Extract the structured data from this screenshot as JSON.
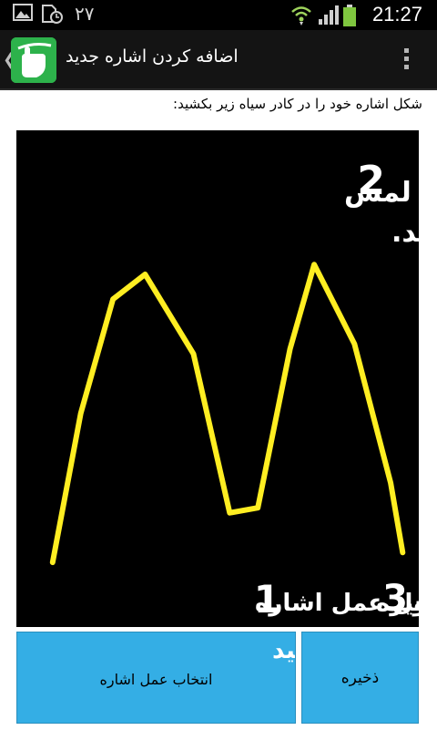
{
  "status_bar": {
    "time": "21:27",
    "notification_count": "۲۷",
    "icons": [
      "image-icon",
      "sd-card-icon",
      "wifi-icon",
      "signal-icon",
      "battery-icon"
    ]
  },
  "action_bar": {
    "title": "اضافه کردن اشاره جدید",
    "logo_icon": "hand-gesture-logo-icon",
    "overflow_icon": "overflow-menu-icon",
    "accent_color": "#2db24b"
  },
  "instruction": "شکل اشاره خود را در کادر سیاه زیر بکشید:",
  "canvas": {
    "background": "#000000",
    "stroke_color": "#ffee22",
    "overlay_lines": [
      "حرکت‌ها را با لمس",
      "صفحه بکشید."
    ],
    "step_2": "2",
    "bottom_step_3": "3",
    "bottom_text_a": "ذخیره",
    "bottom_step_1": "1",
    "bottom_text_b": "اول عمل اشاره",
    "gesture_points": [
      [
        0.09,
        0.87
      ],
      [
        0.16,
        0.57
      ],
      [
        0.24,
        0.34
      ],
      [
        0.32,
        0.29
      ],
      [
        0.44,
        0.45
      ],
      [
        0.53,
        0.77
      ],
      [
        0.6,
        0.76
      ],
      [
        0.68,
        0.44
      ],
      [
        0.74,
        0.27
      ],
      [
        0.84,
        0.43
      ],
      [
        0.93,
        0.71
      ],
      [
        0.96,
        0.85
      ]
    ]
  },
  "buttons": {
    "define": {
      "overlay_text": "را تعریف کنید",
      "label": "انتخاب عمل اشاره"
    },
    "save": {
      "label": "ذخیره"
    },
    "color": "#34aee5"
  }
}
